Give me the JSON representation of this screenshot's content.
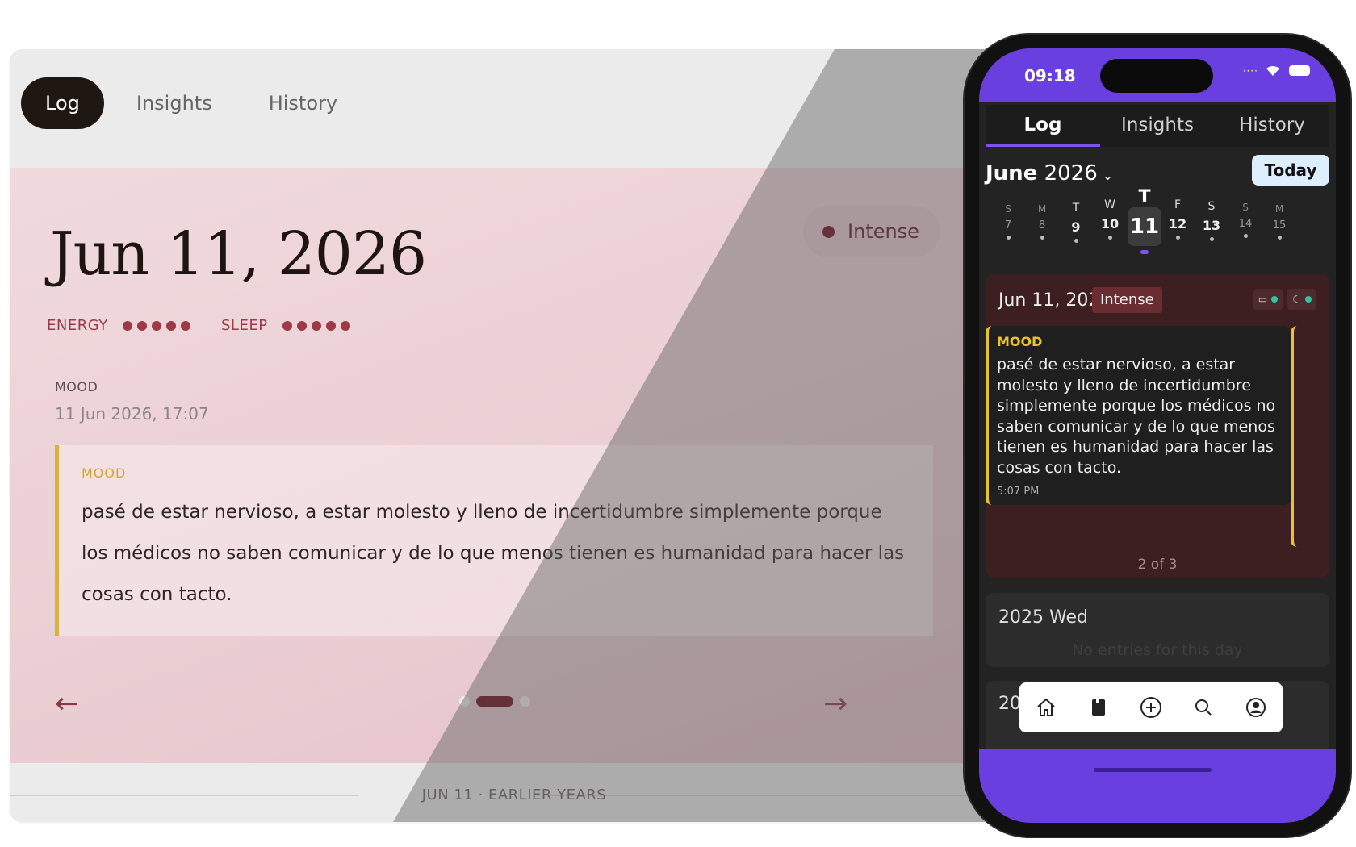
{
  "desktop": {
    "tabs": [
      "Log",
      "Insights",
      "History"
    ],
    "date_title": "Jun 11, 2026",
    "intensity_label": "Intense",
    "energy_label": "ENERGY",
    "energy_level": 5,
    "sleep_label": "SLEEP",
    "sleep_level": 5,
    "mood_section_label": "MOOD",
    "mood_timestamp": "11 Jun 2026, 17:07",
    "quote_label": "MOOD",
    "quote_text": "pasé de estar nervioso, a estar molesto y lleno de incertidumbre simplemente porque los médicos no saben comunicar y de lo que menos tienen es humanidad para hacer las cosas con tacto.",
    "prev_arrow": "←",
    "next_arrow": "→",
    "pager": {
      "current": 2,
      "total": 3
    },
    "earlier_label": "JUN 11 · EARLIER YEARS",
    "colors": {
      "accent": "#6e0c1a",
      "pink": "#eacdd2",
      "quote_border": "#d8b23a",
      "tab_active": "#1f1712"
    }
  },
  "phone": {
    "status_time": "09:18",
    "tabs": [
      "Log",
      "Insights",
      "History"
    ],
    "month_bold": "June",
    "month_year": "2026",
    "today_button": "Today",
    "week": [
      {
        "dow": "S",
        "num": "7"
      },
      {
        "dow": "M",
        "num": "8"
      },
      {
        "dow": "T",
        "num": "9"
      },
      {
        "dow": "W",
        "num": "10"
      },
      {
        "dow": "T",
        "num": "11"
      },
      {
        "dow": "F",
        "num": "12"
      },
      {
        "dow": "S",
        "num": "13"
      },
      {
        "dow": "S",
        "num": "14"
      },
      {
        "dow": "M",
        "num": "15"
      }
    ],
    "entry": {
      "date": "Jun 11, 2026",
      "badge": "Intense",
      "card_label": "MOOD",
      "card_text": "pasé de estar nervioso, a estar molesto y lleno de incertidumbre simplemente porque los médicos no saben comunicar y de lo que menos tienen es humanidad para hacer las cosas con tacto.",
      "card_time": "5:07 PM",
      "counter": "2 of 3"
    },
    "prev_year": {
      "title": "2025 Wed",
      "empty": "No entries for this day"
    },
    "prev_year2": {
      "title": "20"
    },
    "nav_icons": [
      "home-icon",
      "journal-icon",
      "add-circle-icon",
      "search-icon",
      "profile-icon"
    ],
    "colors": {
      "purple": "#6a3fe0",
      "entry_bg": "#3d1f22",
      "yellow": "#e8c233",
      "teal": "#2ec4a4"
    }
  }
}
